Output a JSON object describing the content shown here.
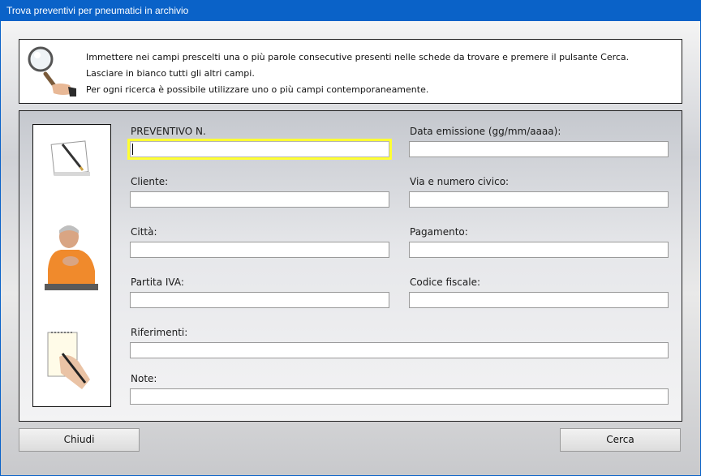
{
  "window": {
    "title": "Trova preventivi per pneumatici in archivio"
  },
  "info": {
    "line1": "Immettere nei campi prescelti una o più parole consecutive presenti nelle schede da trovare e premere il pulsante Cerca.",
    "line2": "Lasciare in bianco tutti gli altri campi.",
    "line3": "Per ogni ricerca è possibile utilizzare uno o più campi contemporaneamente."
  },
  "fields": {
    "preventivo": {
      "label": "PREVENTIVO N.",
      "value": ""
    },
    "data_emissione": {
      "label": "Data emissione (gg/mm/aaaa):",
      "value": ""
    },
    "cliente": {
      "label": "Cliente:",
      "value": ""
    },
    "via": {
      "label": "Via e numero civico:",
      "value": ""
    },
    "citta": {
      "label": "Città:",
      "value": ""
    },
    "pagamento": {
      "label": "Pagamento:",
      "value": ""
    },
    "partita_iva": {
      "label": "Partita IVA:",
      "value": ""
    },
    "codice_fiscale": {
      "label": "Codice fiscale:",
      "value": ""
    },
    "riferimenti": {
      "label": "Riferimenti:",
      "value": ""
    },
    "note": {
      "label": "Note:",
      "value": ""
    }
  },
  "buttons": {
    "close": "Chiudi",
    "search": "Cerca"
  },
  "icons": [
    "magnifier-icon",
    "notepad-pen-icon",
    "person-photo",
    "writing-hand-icon"
  ],
  "colors": {
    "titlebar": "#0a62c8",
    "focus_border": "#ffff33"
  }
}
